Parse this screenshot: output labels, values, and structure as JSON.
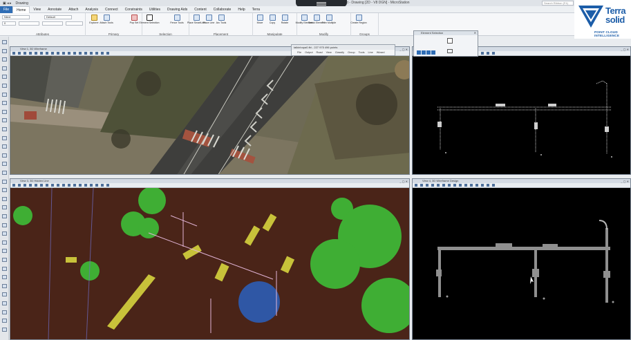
{
  "app": {
    "title": "Untitled Project - Drawing [2D - V8 DGN] - MicroStation",
    "search_placeholder": "Search Ribbon (F4)",
    "workflow": "Drawing"
  },
  "tabs": [
    "File",
    "Home",
    "View",
    "Annotate",
    "Attach",
    "Analysis",
    "Connect",
    "Constraints",
    "Utilities",
    "Drawing Aids",
    "Content",
    "Collaborate",
    "Help",
    "Terra"
  ],
  "active_tab": "Home",
  "ribbon": {
    "attributes": {
      "label": "Attributes",
      "combo1": "Ntext",
      "combo2": "Default",
      "combo3": "0"
    },
    "primary": {
      "label": "Primary",
      "buttons": [
        "Explorer",
        "Attach Tools",
        "Pop Set"
      ]
    },
    "selection": {
      "label": "Selection",
      "buttons": [
        "Element Selection"
      ]
    },
    "placement": {
      "label": "Placement",
      "buttons": [
        "Place SmartLine",
        "Place Line",
        "Arc Tools",
        "Fence Tools"
      ]
    },
    "manipulate": {
      "label": "Manipulate",
      "buttons": [
        "Move",
        "Copy",
        "Rotate"
      ]
    },
    "modify": {
      "label": "Modify",
      "buttons": [
        "Modify Element",
        "Break Element",
        "Trim Multiple"
      ]
    },
    "groups": {
      "label": "Groups",
      "buttons": [
        "Create Region"
      ]
    }
  },
  "logo": {
    "line1": "Terra",
    "line2": "solid",
    "tagline": "POINT CLOUD INTELLIGENCE"
  },
  "floating_bar": {
    "title": "talkinhopa0.fbi - 227 975 496 points",
    "menu": [
      "File",
      "Output",
      "Road",
      "View",
      "Classify",
      "Group",
      "Tools",
      "Line",
      "Wizard"
    ]
  },
  "element_selection": {
    "title": "Element Selection"
  },
  "views": {
    "v1": {
      "title": "View 1, 3D Wireframe"
    },
    "v2": {
      "title": "View 2, 3D Wireframe"
    },
    "v3": {
      "title": "View 3, 3D Hidden Line"
    },
    "v4": {
      "title": "View 4, 3D Wireframe Design"
    }
  },
  "colors": {
    "accent": "#2f6db5",
    "logo_blue": "#1c5da8",
    "ground": "#4a2418",
    "tree": "#3fae34",
    "wire": "#c9c9c9"
  }
}
